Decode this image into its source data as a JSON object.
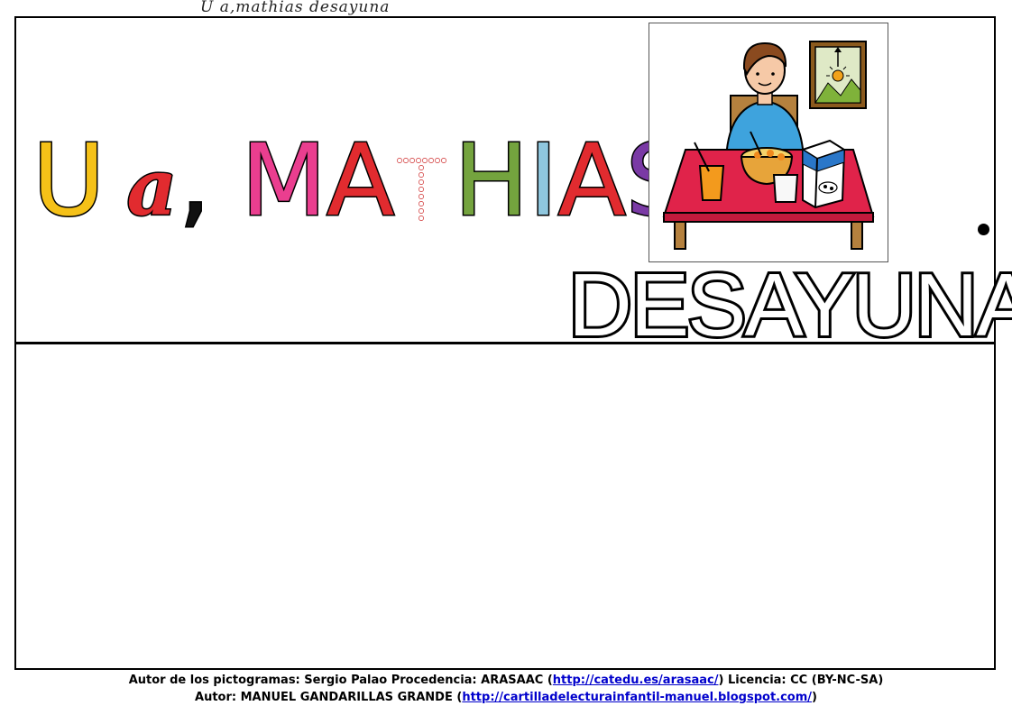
{
  "caption": "U  a,mathias  desayuna",
  "headline": {
    "letters": [
      "U",
      "a",
      ",",
      "M",
      "A",
      "T",
      "H",
      "I",
      "A",
      "S"
    ]
  },
  "verb": "DESAYUNA",
  "pictogram": {
    "icon": "child-eating-breakfast-pictogram"
  },
  "credits": {
    "line1_prefix": "Autor de los pictogramas: Sergio Palao Procedencia: ARASAAC (",
    "line1_link": "http://catedu.es/arasaac/",
    "line1_suffix": ") Licencia: CC (BY-NC-SA)",
    "line2_prefix": "Autor: MANUEL GANDARILLAS GRANDE (",
    "line2_link": "http://cartilladelecturainfantil-manuel.blogspot.com/",
    "line2_suffix": ")"
  },
  "colors": {
    "u": "#f5c118",
    "red": "#e12b2f",
    "pink": "#ea3e8f",
    "green": "#74a33e",
    "light_blue": "#8fc7de",
    "purple": "#7a3aa5"
  }
}
